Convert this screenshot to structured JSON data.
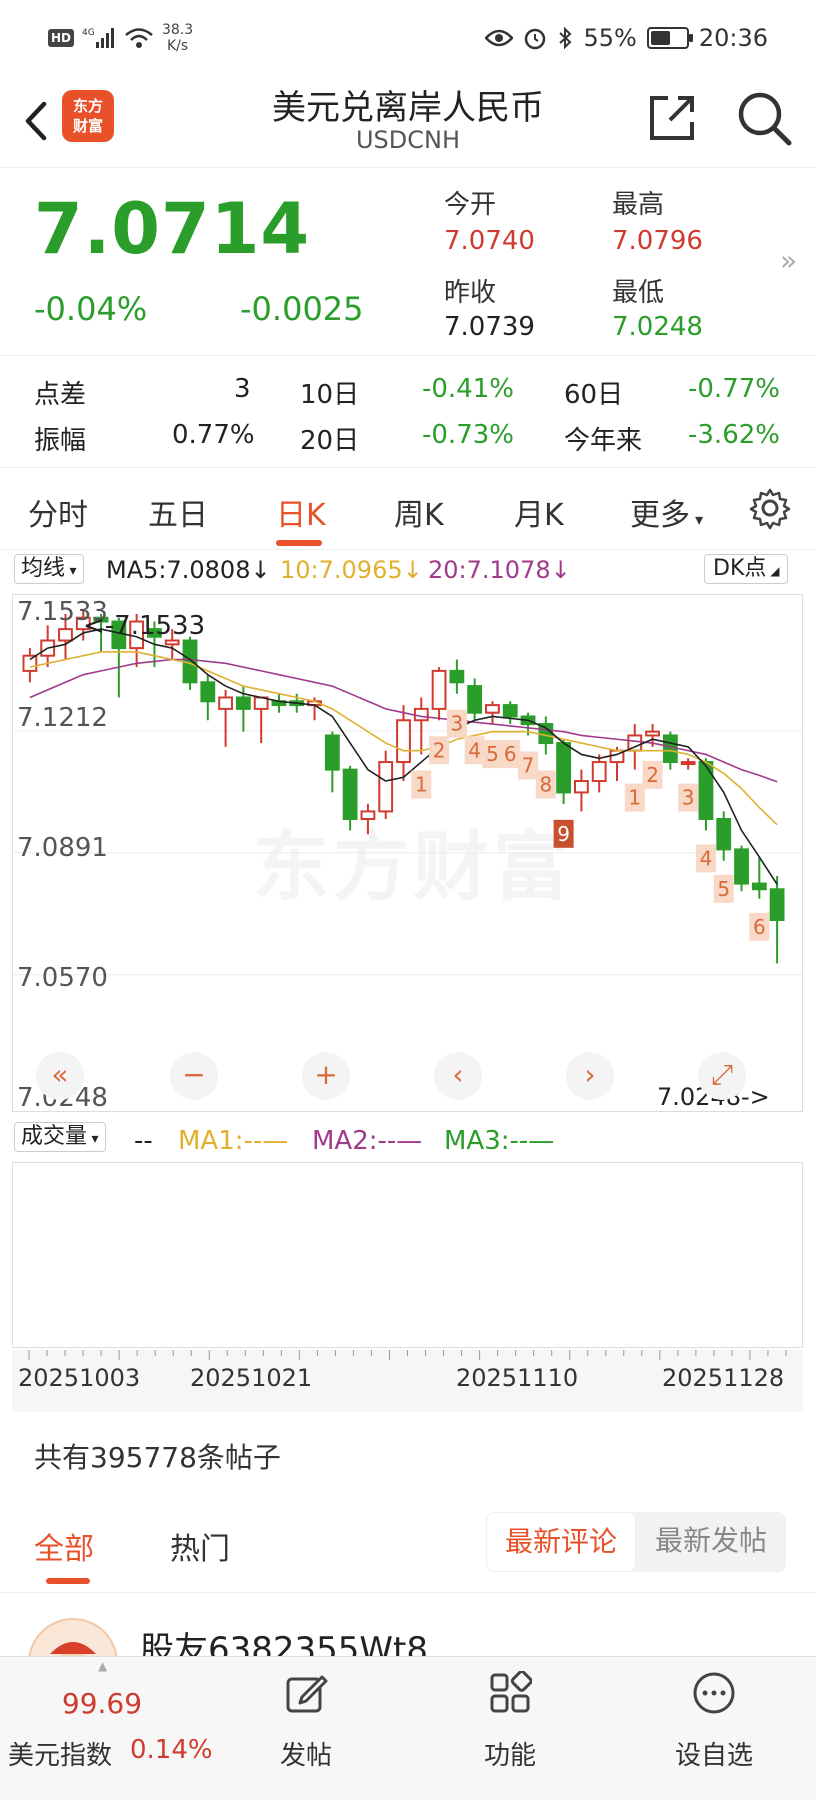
{
  "status_bar": {
    "net_speed": "38.3",
    "net_speed_unit": "K/s",
    "battery": "55%",
    "battery_fraction": 0.55,
    "time": "20:36"
  },
  "header": {
    "logo_line1": "东方",
    "logo_line2": "财富",
    "title": "美元兑离岸人民币",
    "symbol": "USDCNH"
  },
  "quote": {
    "price": "7.0714",
    "change_pct": "-0.04%",
    "change": "-0.0025",
    "open_label": "今开",
    "open": "7.0740",
    "high_label": "最高",
    "high": "7.0796",
    "prev_close_label": "昨收",
    "prev_close": "7.0739",
    "low_label": "最低",
    "low": "7.0248"
  },
  "stats": {
    "spread_label": "点差",
    "spread": "3",
    "d10_label": "10日",
    "d10": "-0.41%",
    "d60_label": "60日",
    "d60": "-0.77%",
    "amp_label": "振幅",
    "amp": "0.77%",
    "d20_label": "20日",
    "d20": "-0.73%",
    "ytd_label": "今年来",
    "ytd": "-3.62%"
  },
  "tabs": [
    "分时",
    "五日",
    "日K",
    "周K",
    "月K",
    "更多"
  ],
  "active_tab": "日K",
  "ma_row": {
    "selector": "均线",
    "ma5": "MA5:7.0808↓",
    "ma10": "10:7.0965↓",
    "ma20": "20:7.1078↓",
    "dk_button": "DK点"
  },
  "colors": {
    "up": "#d03b2f",
    "down": "#2a9d2a",
    "accent": "#e8512a",
    "ma5": "#222222",
    "ma10": "#e0b030",
    "ma20": "#a03a8a"
  },
  "chart": {
    "watermark": "东方财富",
    "max_label": "<-7.1533",
    "min_label": "7.0248->",
    "y_ticks": [
      "7.1533",
      "7.1212",
      "7.0891",
      "7.0570",
      "7.0248"
    ],
    "controls": [
      "«",
      "−",
      "+",
      "‹",
      "›",
      "⤢"
    ],
    "td_marks": [
      "1",
      "2",
      "3",
      "4",
      "5",
      "6",
      "7",
      "8",
      "9",
      "1",
      "2",
      "3",
      "4",
      "5",
      "6"
    ]
  },
  "chart_data": {
    "type": "candlestick",
    "ylim": [
      7.0248,
      7.1533
    ],
    "y_ticks": [
      7.1533,
      7.1212,
      7.0891,
      7.057,
      7.0248
    ],
    "candles": [
      {
        "o": 7.137,
        "h": 7.143,
        "l": 7.134,
        "c": 7.141
      },
      {
        "o": 7.141,
        "h": 7.149,
        "l": 7.138,
        "c": 7.145
      },
      {
        "o": 7.145,
        "h": 7.152,
        "l": 7.14,
        "c": 7.148
      },
      {
        "o": 7.148,
        "h": 7.1533,
        "l": 7.145,
        "c": 7.151
      },
      {
        "o": 7.151,
        "h": 7.152,
        "l": 7.142,
        "c": 7.15
      },
      {
        "o": 7.15,
        "h": 7.151,
        "l": 7.13,
        "c": 7.143
      },
      {
        "o": 7.143,
        "h": 7.152,
        "l": 7.138,
        "c": 7.15
      },
      {
        "o": 7.148,
        "h": 7.15,
        "l": 7.138,
        "c": 7.146
      },
      {
        "o": 7.144,
        "h": 7.148,
        "l": 7.14,
        "c": 7.145
      },
      {
        "o": 7.145,
        "h": 7.146,
        "l": 7.132,
        "c": 7.134
      },
      {
        "o": 7.134,
        "h": 7.136,
        "l": 7.124,
        "c": 7.129
      },
      {
        "o": 7.127,
        "h": 7.132,
        "l": 7.117,
        "c": 7.13
      },
      {
        "o": 7.13,
        "h": 7.133,
        "l": 7.121,
        "c": 7.127
      },
      {
        "o": 7.127,
        "h": 7.13,
        "l": 7.118,
        "c": 7.13
      },
      {
        "o": 7.129,
        "h": 7.131,
        "l": 7.126,
        "c": 7.128
      },
      {
        "o": 7.129,
        "h": 7.131,
        "l": 7.126,
        "c": 7.128
      },
      {
        "o": 7.128,
        "h": 7.13,
        "l": 7.124,
        "c": 7.129
      },
      {
        "o": 7.12,
        "h": 7.121,
        "l": 7.105,
        "c": 7.111
      },
      {
        "o": 7.111,
        "h": 7.112,
        "l": 7.095,
        "c": 7.098
      },
      {
        "o": 7.098,
        "h": 7.102,
        "l": 7.094,
        "c": 7.1
      },
      {
        "o": 7.1,
        "h": 7.116,
        "l": 7.098,
        "c": 7.113
      },
      {
        "o": 7.113,
        "h": 7.128,
        "l": 7.108,
        "c": 7.124
      },
      {
        "o": 7.124,
        "h": 7.13,
        "l": 7.115,
        "c": 7.127
      },
      {
        "o": 7.127,
        "h": 7.138,
        "l": 7.124,
        "c": 7.137
      },
      {
        "o": 7.137,
        "h": 7.14,
        "l": 7.131,
        "c": 7.134
      },
      {
        "o": 7.133,
        "h": 7.135,
        "l": 7.124,
        "c": 7.126
      },
      {
        "o": 7.126,
        "h": 7.129,
        "l": 7.123,
        "c": 7.128
      },
      {
        "o": 7.128,
        "h": 7.129,
        "l": 7.123,
        "c": 7.125
      },
      {
        "o": 7.125,
        "h": 7.126,
        "l": 7.12,
        "c": 7.123
      },
      {
        "o": 7.123,
        "h": 7.125,
        "l": 7.115,
        "c": 7.118
      },
      {
        "o": 7.118,
        "h": 7.119,
        "l": 7.102,
        "c": 7.105
      },
      {
        "o": 7.105,
        "h": 7.111,
        "l": 7.1,
        "c": 7.108
      },
      {
        "o": 7.108,
        "h": 7.115,
        "l": 7.105,
        "c": 7.113
      },
      {
        "o": 7.113,
        "h": 7.117,
        "l": 7.108,
        "c": 7.116
      },
      {
        "o": 7.116,
        "h": 7.123,
        "l": 7.111,
        "c": 7.12
      },
      {
        "o": 7.12,
        "h": 7.123,
        "l": 7.117,
        "c": 7.121
      },
      {
        "o": 7.12,
        "h": 7.121,
        "l": 7.111,
        "c": 7.113
      },
      {
        "o": 7.113,
        "h": 7.114,
        "l": 7.111,
        "c": 7.113
      },
      {
        "o": 7.113,
        "h": 7.114,
        "l": 7.095,
        "c": 7.098
      },
      {
        "o": 7.098,
        "h": 7.1,
        "l": 7.087,
        "c": 7.09
      },
      {
        "o": 7.09,
        "h": 7.091,
        "l": 7.079,
        "c": 7.081
      },
      {
        "o": 7.081,
        "h": 7.088,
        "l": 7.077,
        "c": 7.0795
      },
      {
        "o": 7.0795,
        "h": 7.083,
        "l": 7.06,
        "c": 7.0714
      }
    ],
    "ma5": [
      7.14,
      7.143,
      7.144,
      7.147,
      7.148,
      7.147,
      7.146,
      7.144,
      7.143,
      7.14,
      7.136,
      7.133,
      7.131,
      7.13,
      7.129,
      7.1285,
      7.128,
      7.125,
      7.118,
      7.111,
      7.108,
      7.109,
      7.113,
      7.117,
      7.122,
      7.124,
      7.125,
      7.1245,
      7.124,
      7.122,
      7.118,
      7.115,
      7.114,
      7.115,
      7.117,
      7.119,
      7.118,
      7.117,
      7.112,
      7.105,
      7.095,
      7.088,
      7.0808
    ],
    "ma10": [
      7.138,
      7.139,
      7.14,
      7.141,
      7.142,
      7.142,
      7.142,
      7.141,
      7.14,
      7.139,
      7.137,
      7.135,
      7.133,
      7.132,
      7.131,
      7.13,
      7.129,
      7.127,
      7.124,
      7.121,
      7.118,
      7.116,
      7.116,
      7.117,
      7.119,
      7.12,
      7.121,
      7.121,
      7.121,
      7.12,
      7.119,
      7.118,
      7.117,
      7.116,
      7.116,
      7.116,
      7.116,
      7.115,
      7.113,
      7.11,
      7.106,
      7.101,
      7.0965
    ],
    "ma20": [
      7.13,
      7.132,
      7.134,
      7.136,
      7.137,
      7.138,
      7.139,
      7.1395,
      7.14,
      7.14,
      7.1395,
      7.139,
      7.138,
      7.137,
      7.136,
      7.135,
      7.134,
      7.133,
      7.131,
      7.129,
      7.127,
      7.126,
      7.125,
      7.1245,
      7.124,
      7.1235,
      7.123,
      7.1225,
      7.122,
      7.1215,
      7.121,
      7.12,
      7.1195,
      7.119,
      7.1185,
      7.118,
      7.117,
      7.116,
      7.115,
      7.113,
      7.111,
      7.1095,
      7.1078
    ]
  },
  "volume": {
    "selector": "成交量",
    "value": "--",
    "ma1": "MA1:--—",
    "ma2": "MA2:--—",
    "ma3": "MA3:--—"
  },
  "dates": [
    "20251003",
    "20251021",
    "20251110",
    "20251128"
  ],
  "posts": {
    "count_text": "共有395778条帖子",
    "tabs": [
      "全部",
      "热门"
    ],
    "sort_active": "最新评论",
    "sort_other": "最新发帖",
    "first_user": "股友6382355Wt8"
  },
  "bottom_bar": {
    "index_value": "99.69",
    "index_name": "美元指数",
    "index_change": "0.14%",
    "post_label": "发帖",
    "func_label": "功能",
    "watch_label": "设自选"
  }
}
